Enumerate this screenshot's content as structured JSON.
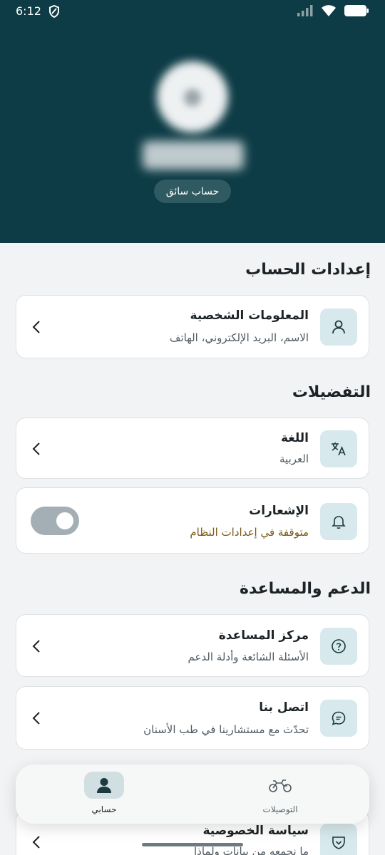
{
  "status_bar": {
    "time": "6:12"
  },
  "profile": {
    "role_chip": "حساب سائق"
  },
  "sections": {
    "account": {
      "title": "إعدادات الحساب",
      "personal_info": {
        "title": "المعلومات الشخصية",
        "subtitle": "الاسم، البريد الإلكتروني، الهاتف"
      }
    },
    "preferences": {
      "title": "التفضيلات",
      "language": {
        "title": "اللغة",
        "subtitle": "العربية"
      },
      "notifications": {
        "title": "الإشعارات",
        "subtitle": "متوقفة في إعدادات النظام",
        "enabled": false
      }
    },
    "support": {
      "title": "الدعم والمساعدة",
      "help_center": {
        "title": "مركز المساعدة",
        "subtitle": "الأسئلة الشائعة وأدلة الدعم"
      },
      "contact": {
        "title": "اتصل بنا",
        "subtitle": "تحدّث مع مستشارينا في طب الأسنان"
      },
      "privacy": {
        "title": "سياسة الخصوصية",
        "subtitle": "ما نجمعه من بيانات ولماذا"
      }
    }
  },
  "bottom_nav": {
    "items": [
      {
        "label": "حسابي",
        "icon": "person-icon",
        "active": true
      },
      {
        "label": "التوصيلات",
        "icon": "motorcycle-icon",
        "active": false
      }
    ]
  },
  "colors": {
    "header_bg": "#0e3c46",
    "accent_box": "#d7e9ec",
    "warning_text": "#7a5a15"
  }
}
